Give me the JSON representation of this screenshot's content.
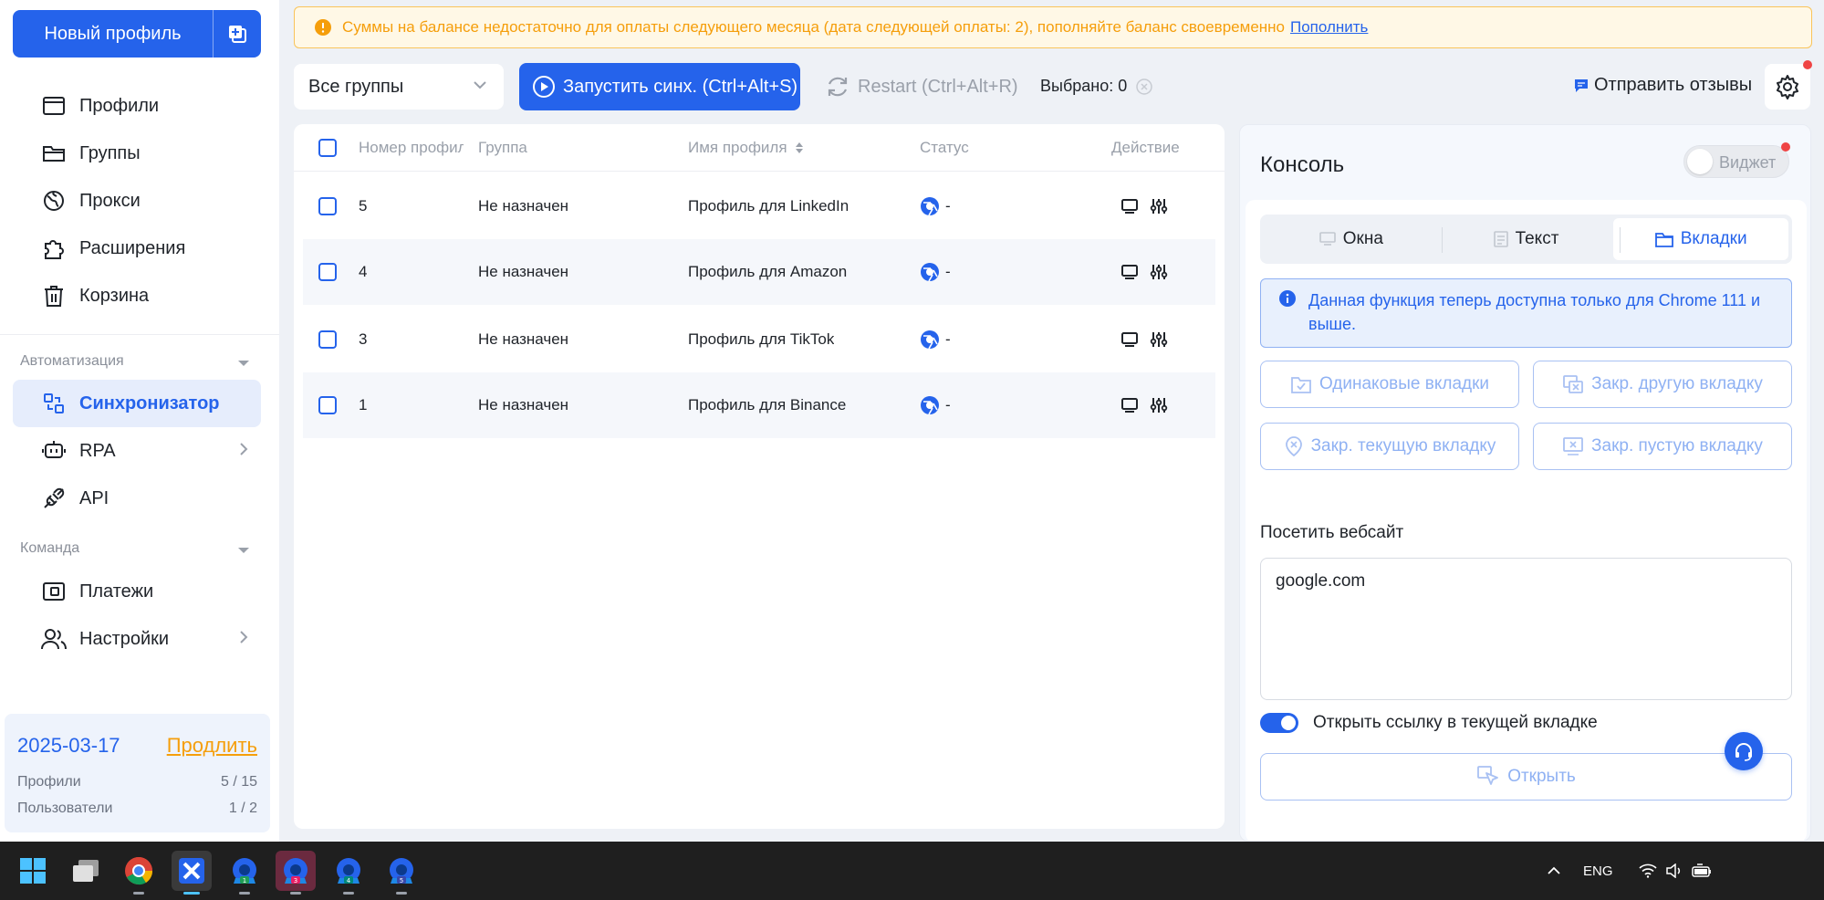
{
  "sidebar": {
    "new_profile_label": "Новый профиль",
    "nav_main": [
      {
        "label": "Профили",
        "icon": "window-icon"
      },
      {
        "label": "Группы",
        "icon": "folder-icon"
      },
      {
        "label": "Прокси",
        "icon": "globe-icon"
      },
      {
        "label": "Расширения",
        "icon": "puzzle-icon"
      },
      {
        "label": "Корзина",
        "icon": "trash-icon"
      }
    ],
    "section_automation": "Автоматизация",
    "nav_automation": [
      {
        "label": "Синхронизатор",
        "icon": "sync-icon",
        "active": true
      },
      {
        "label": "RPA",
        "icon": "robot-icon"
      },
      {
        "label": "API",
        "icon": "plug-icon"
      }
    ],
    "section_team": "Команда",
    "nav_team": [
      {
        "label": "Платежи",
        "icon": "wallet-icon"
      },
      {
        "label": "Настройки",
        "icon": "users-icon"
      }
    ],
    "plan": {
      "date": "2025-03-17",
      "renew_label": "Продлить",
      "profiles_label": "Профили",
      "profiles_value": "5 / 15",
      "users_label": "Пользователи",
      "users_value": "1 / 2"
    }
  },
  "warning": {
    "text": "Суммы на балансе недостаточно для оплаты следующего месяца (дата следующей оплаты: 2), пополняйте баланс своевременно",
    "link": "Пополнить"
  },
  "toolbar": {
    "group_select": "Все группы",
    "start_sync": "Запустить синх. (Ctrl+Alt+S)",
    "restart": "Restart (Ctrl+Alt+R)",
    "selected": "Выбрано: 0",
    "feedback": "Отправить отзывы"
  },
  "table": {
    "headers": {
      "number": "Номер профиля",
      "group": "Группа",
      "name": "Имя профиля",
      "status": "Статус",
      "action": "Действие"
    },
    "rows": [
      {
        "number": "5",
        "group": "Не назначен",
        "name": "Профиль для LinkedIn",
        "status": "-"
      },
      {
        "number": "4",
        "group": "Не назначен",
        "name": "Профиль для Amazon",
        "status": "-"
      },
      {
        "number": "3",
        "group": "Не назначен",
        "name": "Профиль для TikTok",
        "status": "-"
      },
      {
        "number": "1",
        "group": "Не назначен",
        "name": "Профиль для Binance",
        "status": "-"
      }
    ]
  },
  "console": {
    "title": "Консоль",
    "widget_label": "Виджет",
    "tabs": [
      {
        "label": "Окна",
        "icon": "monitor-icon"
      },
      {
        "label": "Текст",
        "icon": "document-icon"
      },
      {
        "label": "Вкладки",
        "icon": "tabs-icon",
        "active": true
      }
    ],
    "info": "Данная функция теперь доступна только для Chrome 111 и выше.",
    "actions": {
      "same_tabs": "Одинаковые вкладки",
      "close_other": "Закр. другую вкладку",
      "close_current": "Закр. текущую вкладку",
      "close_empty": "Закр. пустую вкладку"
    },
    "visit_label": "Посетить вебсайт",
    "url_value": "google.com",
    "open_current_tab_label": "Открыть ссылку в текущей вкладке",
    "open_button": "Открыть"
  },
  "taskbar": {
    "language": "ENG",
    "apps": [
      {
        "name": "windows-start-icon"
      },
      {
        "name": "task-view-icon"
      },
      {
        "name": "chrome-icon"
      },
      {
        "name": "app-launcher-icon",
        "active": true
      },
      {
        "name": "profile-browser-icon",
        "badge": "1"
      },
      {
        "name": "profile-browser-icon",
        "badge": "3"
      },
      {
        "name": "profile-browser-icon",
        "badge": "4"
      },
      {
        "name": "profile-browser-icon",
        "badge": "5"
      }
    ]
  },
  "colors": {
    "primary": "#2563eb",
    "warning": "#f59e0b",
    "danger": "#ef4444"
  }
}
